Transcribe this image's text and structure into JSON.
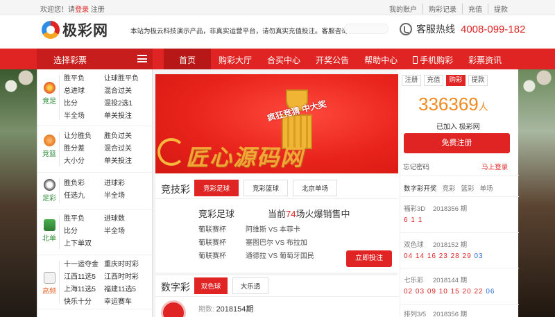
{
  "topbar": {
    "welcome": "欢迎您！请",
    "login": "登录",
    "register": "注册",
    "links": [
      "我的账户",
      "购彩记录",
      "充值",
      "提款"
    ]
  },
  "header": {
    "logo_text": "极彩网",
    "notice": "本站为极云科技演示产品，非真实运营平台，请勿真实充值投注。客服咨询",
    "hotline_label": "客服热线",
    "hotline_number": "4008-099-182"
  },
  "nav": {
    "category_label": "选择彩票",
    "items": [
      {
        "label": "首页",
        "active": true
      },
      {
        "label": "购彩大厅",
        "active": false
      },
      {
        "label": "合买中心",
        "active": false
      },
      {
        "label": "开奖公告",
        "active": false
      },
      {
        "label": "帮助中心",
        "active": false
      },
      {
        "label": "手机购彩",
        "active": false
      },
      {
        "label": "彩票资讯",
        "active": false
      }
    ]
  },
  "sidebar": [
    {
      "name": "竞足",
      "icon": "soccer-ball-icon",
      "color": "#e8672a",
      "items": [
        "胜平负",
        "让球胜平负",
        "总进球",
        "混合过关",
        "比分",
        "混投2选1",
        "半全场",
        "单关投注"
      ]
    },
    {
      "name": "竞篮",
      "icon": "basketball-icon",
      "color": "#e8822a",
      "items": [
        "让分胜负",
        "胜负过关",
        "胜分差",
        "混合过关",
        "大小分",
        "单关投注"
      ]
    },
    {
      "name": "足彩",
      "icon": "soccer-ball-icon",
      "color": "#444444",
      "items": [
        "胜负彩",
        "进球彩",
        "任选九",
        "半全场"
      ]
    },
    {
      "name": "北单",
      "icon": "beijing-single-icon",
      "color": "#2e7d32",
      "items": [
        "胜平负",
        "进球数",
        "比分",
        "半全场",
        "上下单双"
      ]
    },
    {
      "name": "高频",
      "icon": "dice-icon",
      "color": "#e8672a",
      "items": [
        "十一运夺金",
        "重庆时时彩",
        "江西11选5",
        "江西时时彩",
        "上海11选5",
        "福建11选5",
        "快乐十分",
        "幸运赛车"
      ]
    }
  ],
  "banner": {
    "tag": "疯狂竞猜 中大奖",
    "watermark": "匠心源码网"
  },
  "jingji": {
    "title": "竞技彩",
    "tabs": [
      "竞彩足球",
      "竞彩篮球",
      "北京单场"
    ],
    "game_name": "竞彩足球",
    "count_prefix": "当前",
    "count": "74",
    "count_suffix": "场火爆销售中",
    "matches": [
      {
        "league": "葡联赛杯",
        "home": "阿维斯",
        "vs": "VS",
        "away": "本菲卡"
      },
      {
        "league": "葡联赛杯",
        "home": "塞图巴尔",
        "vs": "VS",
        "away": "布拉加"
      },
      {
        "league": "葡联赛杯",
        "home": "通德拉",
        "vs": "VS",
        "away": "葡萄牙国民"
      }
    ],
    "bet_button": "立即投注"
  },
  "shuzi": {
    "title": "数字彩",
    "tabs": [
      "双色球",
      "大乐透"
    ],
    "issue_label": "期数:",
    "issue": "2018154期"
  },
  "account": {
    "tabs": [
      "注册",
      "充值",
      "购彩",
      "提款"
    ],
    "active_tab": "购彩",
    "count": "336369",
    "count_unit": "人",
    "joined": "已加入 极彩网",
    "register_button": "免费注册",
    "forgot": "忘记密码",
    "login_now": "马上登录"
  },
  "draws": {
    "tabs": [
      "数字彩开奖",
      "竞彩",
      "篮彩",
      "单场"
    ],
    "list": [
      {
        "name": "福彩3D",
        "issue": "2018356 期",
        "red": [
          "6",
          "1",
          "1"
        ],
        "blue": []
      },
      {
        "name": "双色球",
        "issue": "2018152 期",
        "red": [
          "04",
          "14",
          "16",
          "23",
          "28",
          "29"
        ],
        "blue": [
          "03"
        ]
      },
      {
        "name": "七乐彩",
        "issue": "2018144 期",
        "red": [
          "02",
          "03",
          "09",
          "10",
          "15",
          "20",
          "22"
        ],
        "blue": [
          "06"
        ]
      },
      {
        "name": "排列3/5",
        "issue": "2018356 期",
        "red": [],
        "blue": []
      }
    ]
  },
  "colors": {
    "brand_red": "#e02424",
    "accent_orange": "#f08a1f"
  }
}
